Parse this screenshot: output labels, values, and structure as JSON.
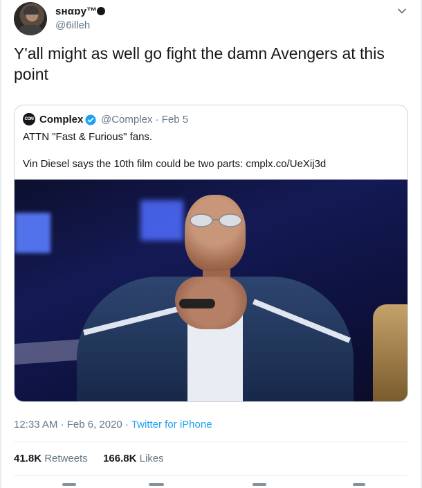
{
  "author": {
    "display_name": "sнαɒy™",
    "handle": "@6illeh"
  },
  "tweet_text": "Y'all might as well go fight the damn Avengers at this point",
  "quoted": {
    "avatar_label": "COM PLX",
    "name": "Complex",
    "handle_date": "@Complex · Feb 5",
    "line1": "ATTN \"Fast & Furious\" fans.",
    "line2": "Vin Diesel says the 10th film could be two parts: cmplx.co/UeXij3d"
  },
  "meta": {
    "time_date": "12:33 AM · Feb 6, 2020 · ",
    "source": "Twitter for iPhone"
  },
  "stats": {
    "retweets_count": "41.8K",
    "retweets_label": " Retweets",
    "likes_count": "166.8K",
    "likes_label": " Likes"
  },
  "icons": {
    "caret": "chevron-down-icon",
    "verified": "verified-icon"
  },
  "colors": {
    "link": "#1da1f2",
    "secondary_text": "#657786",
    "border": "#ccd6dd"
  }
}
